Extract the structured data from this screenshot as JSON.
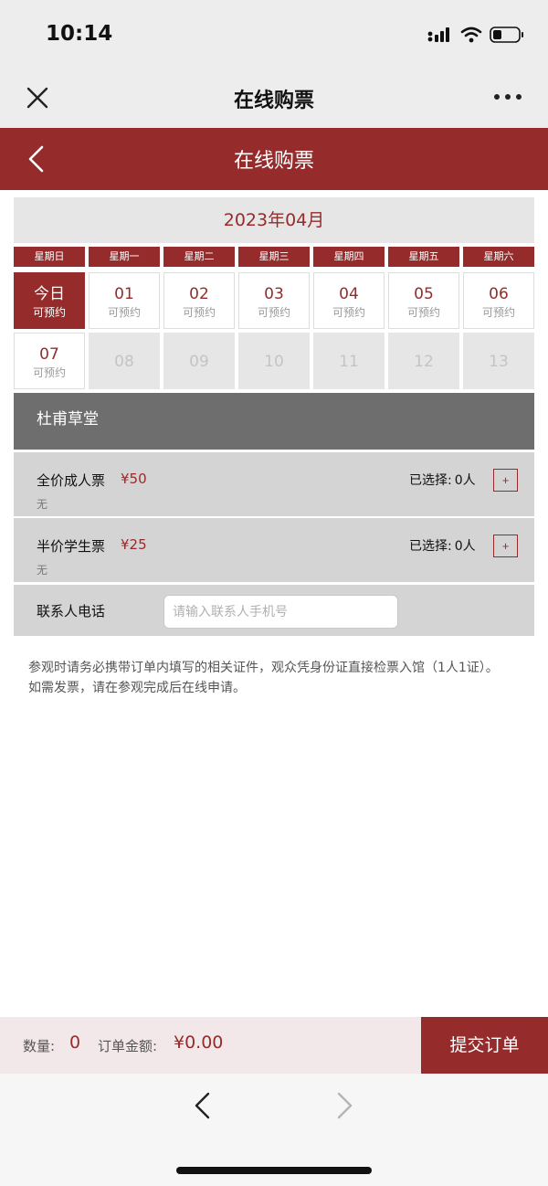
{
  "status": {
    "time": "10:14",
    "icons": [
      "signal-icon",
      "wifi-icon",
      "battery-icon"
    ]
  },
  "nav": {
    "title": "在线购票",
    "close_icon": "close-icon",
    "more_icon": "more-icon"
  },
  "header": {
    "title": "在线购票",
    "back_icon": "chevron-left-icon"
  },
  "calendar": {
    "month": "2023年04月",
    "weekdays": [
      "星期日",
      "星期一",
      "星期二",
      "星期三",
      "星期四",
      "星期五",
      "星期六"
    ],
    "days": [
      {
        "label": "今日",
        "status": "可预约",
        "state": "today"
      },
      {
        "label": "01",
        "status": "可预约",
        "state": "available"
      },
      {
        "label": "02",
        "status": "可预约",
        "state": "available"
      },
      {
        "label": "03",
        "status": "可预约",
        "state": "available"
      },
      {
        "label": "04",
        "status": "可预约",
        "state": "available"
      },
      {
        "label": "05",
        "status": "可预约",
        "state": "available"
      },
      {
        "label": "06",
        "status": "可预约",
        "state": "available"
      },
      {
        "label": "07",
        "status": "可预约",
        "state": "available"
      },
      {
        "label": "08",
        "status": "",
        "state": "disabled"
      },
      {
        "label": "09",
        "status": "",
        "state": "disabled"
      },
      {
        "label": "10",
        "status": "",
        "state": "disabled"
      },
      {
        "label": "11",
        "status": "",
        "state": "disabled"
      },
      {
        "label": "12",
        "status": "",
        "state": "disabled"
      },
      {
        "label": "13",
        "status": "",
        "state": "disabled"
      }
    ]
  },
  "venue": {
    "name": "杜甫草堂"
  },
  "tickets": [
    {
      "name": "全价成人票",
      "price": "¥50",
      "note": "无",
      "selected_label": "已选择:",
      "selected_count": "0人",
      "add_label": "+"
    },
    {
      "name": "半价学生票",
      "price": "¥25",
      "note": "无",
      "selected_label": "已选择:",
      "selected_count": "0人",
      "add_label": "+"
    }
  ],
  "contact": {
    "label": "联系人电话",
    "placeholder": "请输入联系人手机号",
    "value": ""
  },
  "notice": {
    "line1": "参观时请务必携带订单内填写的相关证件，观众凭身份证直接检票入馆（1人1证）。",
    "line2": "如需发票，请在参观完成后在线申请。"
  },
  "order": {
    "qty_label": "数量:",
    "qty_value": "0",
    "amount_label": "订单金额:",
    "amount_value": "¥0.00",
    "submit_label": "提交订单"
  },
  "browser": {
    "back_icon": "chevron-left-icon",
    "forward_icon": "chevron-right-icon"
  },
  "colors": {
    "brand": "#962b2b",
    "venue_bar": "#6e6e6e",
    "panel": "#d4d4d4",
    "bottom_bar": "#f2e8e9"
  }
}
